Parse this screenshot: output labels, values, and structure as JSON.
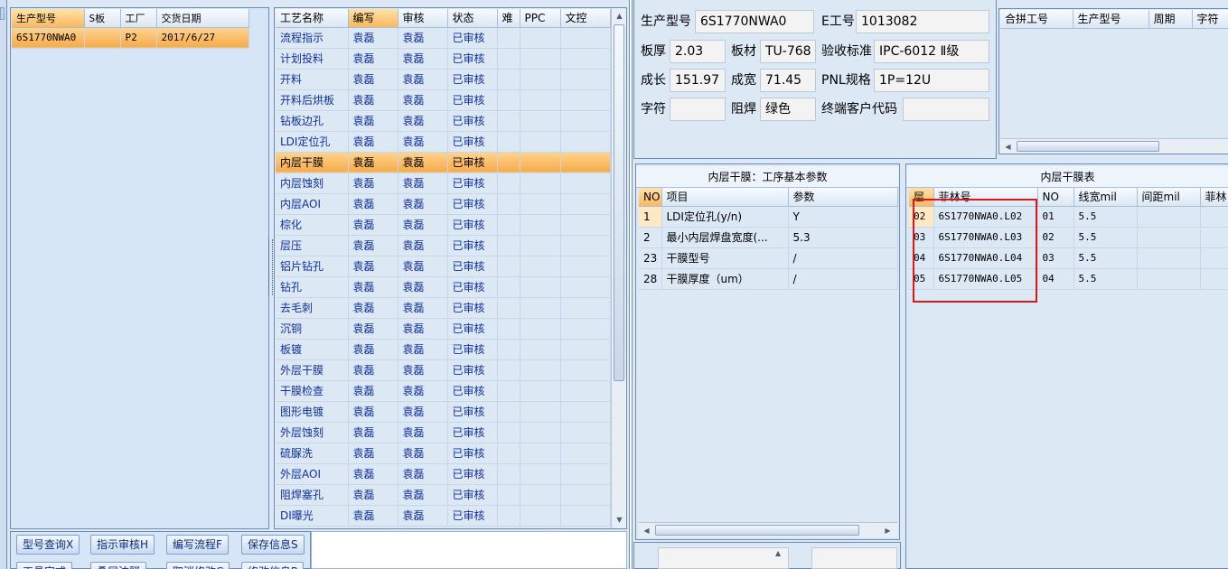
{
  "model_list": {
    "headers": [
      "生产型号",
      "S板",
      "工厂",
      "交货日期"
    ],
    "rows": [
      [
        "6S1770NWA0",
        "",
        "P2",
        "2017/6/27"
      ]
    ]
  },
  "process_list": {
    "headers": [
      "工艺名称",
      "编写",
      "审核",
      "状态",
      "难",
      "PPC",
      "文控"
    ],
    "rows": [
      [
        "流程指示",
        "袁磊",
        "袁磊",
        "已审核"
      ],
      [
        "计划投料",
        "袁磊",
        "袁磊",
        "已审核"
      ],
      [
        "开料",
        "袁磊",
        "袁磊",
        "已审核"
      ],
      [
        "开料后烘板",
        "袁磊",
        "袁磊",
        "已审核"
      ],
      [
        "钻板边孔",
        "袁磊",
        "袁磊",
        "已审核"
      ],
      [
        "LDI定位孔",
        "袁磊",
        "袁磊",
        "已审核"
      ],
      [
        "内层干膜",
        "袁磊",
        "袁磊",
        "已审核"
      ],
      [
        "内层蚀刻",
        "袁磊",
        "袁磊",
        "已审核"
      ],
      [
        "内层AOI",
        "袁磊",
        "袁磊",
        "已审核"
      ],
      [
        "棕化",
        "袁磊",
        "袁磊",
        "已审核"
      ],
      [
        "层压",
        "袁磊",
        "袁磊",
        "已审核"
      ],
      [
        "铝片钻孔",
        "袁磊",
        "袁磊",
        "已审核"
      ],
      [
        "钻孔",
        "袁磊",
        "袁磊",
        "已审核"
      ],
      [
        "去毛刺",
        "袁磊",
        "袁磊",
        "已审核"
      ],
      [
        "沉铜",
        "袁磊",
        "袁磊",
        "已审核"
      ],
      [
        "板镀",
        "袁磊",
        "袁磊",
        "已审核"
      ],
      [
        "外层干膜",
        "袁磊",
        "袁磊",
        "已审核"
      ],
      [
        "干膜检查",
        "袁磊",
        "袁磊",
        "已审核"
      ],
      [
        "图形电镀",
        "袁磊",
        "袁磊",
        "已审核"
      ],
      [
        "外层蚀刻",
        "袁磊",
        "袁磊",
        "已审核"
      ],
      [
        "硫脲洗",
        "袁磊",
        "袁磊",
        "已审核"
      ],
      [
        "外层AOI",
        "袁磊",
        "袁磊",
        "已审核"
      ],
      [
        "阻焊塞孔",
        "袁磊",
        "袁磊",
        "已审核"
      ],
      [
        "DI曝光",
        "袁磊",
        "袁磊",
        "已审核"
      ]
    ],
    "selected_index": 6
  },
  "info": {
    "model_label": "生产型号",
    "model_value": "6S1770NWA0",
    "e_label": "E工号",
    "e_value": "1013082",
    "thick_label": "板厚",
    "thick_value": "2.03",
    "material_label": "板材",
    "material_value": "TU-768",
    "standard_label": "验收标准",
    "standard_value": "IPC-6012 Ⅱ级",
    "length_label": "成长",
    "length_value": "151.97",
    "width_label": "成宽",
    "width_value": "71.45",
    "pnl_label": "PNL规格",
    "pnl_value": "1P=12U",
    "char_label": "字符",
    "char_value": "",
    "mask_label": "阻焊",
    "mask_value": "绿色",
    "customer_label": "终端客户代码",
    "customer_value": ""
  },
  "merge_table": {
    "headers": [
      "合拼工号",
      "生产型号",
      "周期",
      "字符"
    ]
  },
  "params": {
    "title": "内层干膜：工序基本参数",
    "headers": [
      "NO",
      "项目",
      "参数"
    ],
    "rows": [
      [
        "1",
        "LDI定位孔(y/n)",
        "Y"
      ],
      [
        "2",
        "最小内层焊盘宽度(...",
        "5.3"
      ],
      [
        "23",
        "干膜型号",
        "/"
      ],
      [
        "28",
        "干膜厚度（um）",
        "/"
      ]
    ]
  },
  "film": {
    "title": "内层干膜表",
    "headers": [
      "层",
      "菲林号",
      "NO",
      "线宽mil",
      "间距mil",
      "菲林"
    ],
    "rows": [
      [
        "02",
        "6S1770NWA0.L02",
        "01",
        "5.5",
        "",
        ""
      ],
      [
        "03",
        "6S1770NWA0.L03",
        "02",
        "5.5",
        "",
        ""
      ],
      [
        "04",
        "6S1770NWA0.L04",
        "03",
        "5.5",
        "",
        ""
      ],
      [
        "05",
        "6S1770NWA0.L05",
        "04",
        "5.5",
        "",
        ""
      ]
    ]
  },
  "buttons": {
    "row1": [
      "型号查询X",
      "指示审核H",
      "编写流程F",
      "保存信息S"
    ],
    "row2": [
      "工具定式",
      "叠层注释",
      "取消修改C",
      "修改信息P"
    ]
  },
  "colors": {
    "selection": "#f6aa4a",
    "panel": "#d7e6f7",
    "annotation": "#d9181c"
  }
}
